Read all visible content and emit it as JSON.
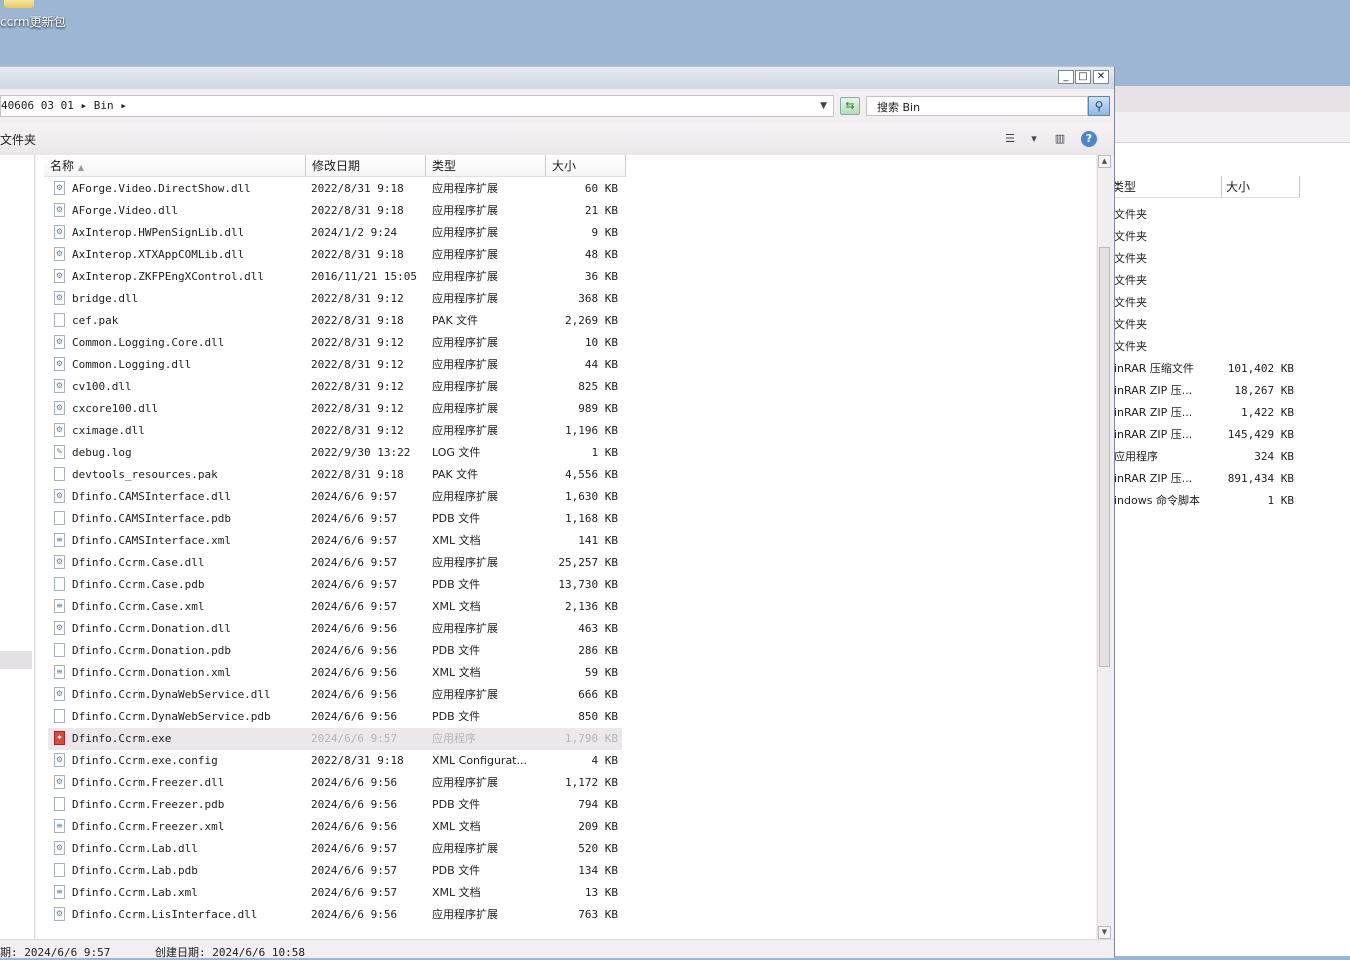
{
  "desktop": {
    "icon_label": "ccrm更新包"
  },
  "window": {
    "buttons": {
      "minimize": "_",
      "maximize": "□",
      "close": "✕"
    },
    "address": {
      "crumb": "40606 03 01 ▸ Bin ▸"
    },
    "search": {
      "placeholder": "搜索 Bin"
    },
    "toolbar": {
      "left_label": "文件夹"
    }
  },
  "columns": {
    "name": "名称",
    "date": "修改日期",
    "type": "类型",
    "size": "大小"
  },
  "files": [
    {
      "name": "AForge.Video.DirectShow.dll",
      "date": "2022/8/31 9:18",
      "type": "应用程序扩展",
      "size": "60 KB",
      "icon": "dll"
    },
    {
      "name": "AForge.Video.dll",
      "date": "2022/8/31 9:18",
      "type": "应用程序扩展",
      "size": "21 KB",
      "icon": "dll"
    },
    {
      "name": "AxInterop.HWPenSignLib.dll",
      "date": "2024/1/2 9:24",
      "type": "应用程序扩展",
      "size": "9 KB",
      "icon": "dll"
    },
    {
      "name": "AxInterop.XTXAppCOMLib.dll",
      "date": "2022/8/31 9:18",
      "type": "应用程序扩展",
      "size": "48 KB",
      "icon": "dll"
    },
    {
      "name": "AxInterop.ZKFPEngXControl.dll",
      "date": "2016/11/21 15:05",
      "type": "应用程序扩展",
      "size": "36 KB",
      "icon": "dll"
    },
    {
      "name": "bridge.dll",
      "date": "2022/8/31 9:12",
      "type": "应用程序扩展",
      "size": "368 KB",
      "icon": "dll"
    },
    {
      "name": "cef.pak",
      "date": "2022/8/31 9:18",
      "type": "PAK 文件",
      "size": "2,269 KB",
      "icon": "file"
    },
    {
      "name": "Common.Logging.Core.dll",
      "date": "2022/8/31 9:12",
      "type": "应用程序扩展",
      "size": "10 KB",
      "icon": "dll"
    },
    {
      "name": "Common.Logging.dll",
      "date": "2022/8/31 9:12",
      "type": "应用程序扩展",
      "size": "44 KB",
      "icon": "dll"
    },
    {
      "name": "cv100.dll",
      "date": "2022/8/31 9:12",
      "type": "应用程序扩展",
      "size": "825 KB",
      "icon": "dll"
    },
    {
      "name": "cxcore100.dll",
      "date": "2022/8/31 9:12",
      "type": "应用程序扩展",
      "size": "989 KB",
      "icon": "dll"
    },
    {
      "name": "cximage.dll",
      "date": "2022/8/31 9:12",
      "type": "应用程序扩展",
      "size": "1,196 KB",
      "icon": "dll"
    },
    {
      "name": "debug.log",
      "date": "2022/9/30 13:22",
      "type": "LOG 文件",
      "size": "1 KB",
      "icon": "log"
    },
    {
      "name": "devtools_resources.pak",
      "date": "2022/8/31 9:18",
      "type": "PAK 文件",
      "size": "4,556 KB",
      "icon": "file"
    },
    {
      "name": "Dfinfo.CAMSInterface.dll",
      "date": "2024/6/6 9:57",
      "type": "应用程序扩展",
      "size": "1,630 KB",
      "icon": "dll"
    },
    {
      "name": "Dfinfo.CAMSInterface.pdb",
      "date": "2024/6/6 9:57",
      "type": "PDB 文件",
      "size": "1,168 KB",
      "icon": "file"
    },
    {
      "name": "Dfinfo.CAMSInterface.xml",
      "date": "2024/6/6 9:57",
      "type": "XML 文档",
      "size": "141 KB",
      "icon": "xml"
    },
    {
      "name": "Dfinfo.Ccrm.Case.dll",
      "date": "2024/6/6 9:57",
      "type": "应用程序扩展",
      "size": "25,257 KB",
      "icon": "dll"
    },
    {
      "name": "Dfinfo.Ccrm.Case.pdb",
      "date": "2024/6/6 9:57",
      "type": "PDB 文件",
      "size": "13,730 KB",
      "icon": "file"
    },
    {
      "name": "Dfinfo.Ccrm.Case.xml",
      "date": "2024/6/6 9:57",
      "type": "XML 文档",
      "size": "2,136 KB",
      "icon": "xml"
    },
    {
      "name": "Dfinfo.Ccrm.Donation.dll",
      "date": "2024/6/6 9:56",
      "type": "应用程序扩展",
      "size": "463 KB",
      "icon": "dll"
    },
    {
      "name": "Dfinfo.Ccrm.Donation.pdb",
      "date": "2024/6/6 9:56",
      "type": "PDB 文件",
      "size": "286 KB",
      "icon": "file"
    },
    {
      "name": "Dfinfo.Ccrm.Donation.xml",
      "date": "2024/6/6 9:56",
      "type": "XML 文档",
      "size": "59 KB",
      "icon": "xml"
    },
    {
      "name": "Dfinfo.Ccrm.DynaWebService.dll",
      "date": "2024/6/6 9:56",
      "type": "应用程序扩展",
      "size": "666 KB",
      "icon": "dll"
    },
    {
      "name": "Dfinfo.Ccrm.DynaWebService.pdb",
      "date": "2024/6/6 9:56",
      "type": "PDB 文件",
      "size": "850 KB",
      "icon": "file"
    },
    {
      "name": "Dfinfo.Ccrm.exe",
      "date": "2024/6/6 9:57",
      "type": "应用程序",
      "size": "1,790 KB",
      "icon": "exe",
      "selected": true
    },
    {
      "name": "Dfinfo.Ccrm.exe.config",
      "date": "2022/8/31 9:18",
      "type": "XML Configurat...",
      "size": "4 KB",
      "icon": "config"
    },
    {
      "name": "Dfinfo.Ccrm.Freezer.dll",
      "date": "2024/6/6 9:56",
      "type": "应用程序扩展",
      "size": "1,172 KB",
      "icon": "dll"
    },
    {
      "name": "Dfinfo.Ccrm.Freezer.pdb",
      "date": "2024/6/6 9:56",
      "type": "PDB 文件",
      "size": "794 KB",
      "icon": "file"
    },
    {
      "name": "Dfinfo.Ccrm.Freezer.xml",
      "date": "2024/6/6 9:56",
      "type": "XML 文档",
      "size": "209 KB",
      "icon": "xml"
    },
    {
      "name": "Dfinfo.Ccrm.Lab.dll",
      "date": "2024/6/6 9:57",
      "type": "应用程序扩展",
      "size": "520 KB",
      "icon": "dll"
    },
    {
      "name": "Dfinfo.Ccrm.Lab.pdb",
      "date": "2024/6/6 9:57",
      "type": "PDB 文件",
      "size": "134 KB",
      "icon": "file"
    },
    {
      "name": "Dfinfo.Ccrm.Lab.xml",
      "date": "2024/6/6 9:57",
      "type": "XML 文档",
      "size": "13 KB",
      "icon": "xml"
    },
    {
      "name": "Dfinfo.Ccrm.LisInterface.dll",
      "date": "2024/6/6 9:56",
      "type": "应用程序扩展",
      "size": "763 KB",
      "icon": "dll"
    }
  ],
  "status": {
    "modified": "期: 2024/6/6 9:57",
    "created": "创建日期: 2024/6/6 10:58"
  },
  "bg_window": {
    "col_type": "类型",
    "col_size": "大小",
    "rows": [
      {
        "type": "文件夹",
        "size": ""
      },
      {
        "type": "文件夹",
        "size": ""
      },
      {
        "type": "文件夹",
        "size": ""
      },
      {
        "type": "文件夹",
        "size": ""
      },
      {
        "type": "文件夹",
        "size": ""
      },
      {
        "type": "文件夹",
        "size": ""
      },
      {
        "type": "文件夹",
        "size": ""
      },
      {
        "type": "inRAR 压缩文件",
        "size": "101,402 KB"
      },
      {
        "type": "inRAR ZIP 压...",
        "size": "18,267 KB"
      },
      {
        "type": "inRAR ZIP 压...",
        "size": "1,422 KB"
      },
      {
        "type": "inRAR ZIP 压...",
        "size": "145,429 KB"
      },
      {
        "type": "应用程序",
        "size": "324 KB"
      },
      {
        "type": "inRAR ZIP 压...",
        "size": "891,434 KB"
      },
      {
        "type": "indows 命令脚本",
        "size": "1 KB"
      }
    ]
  }
}
